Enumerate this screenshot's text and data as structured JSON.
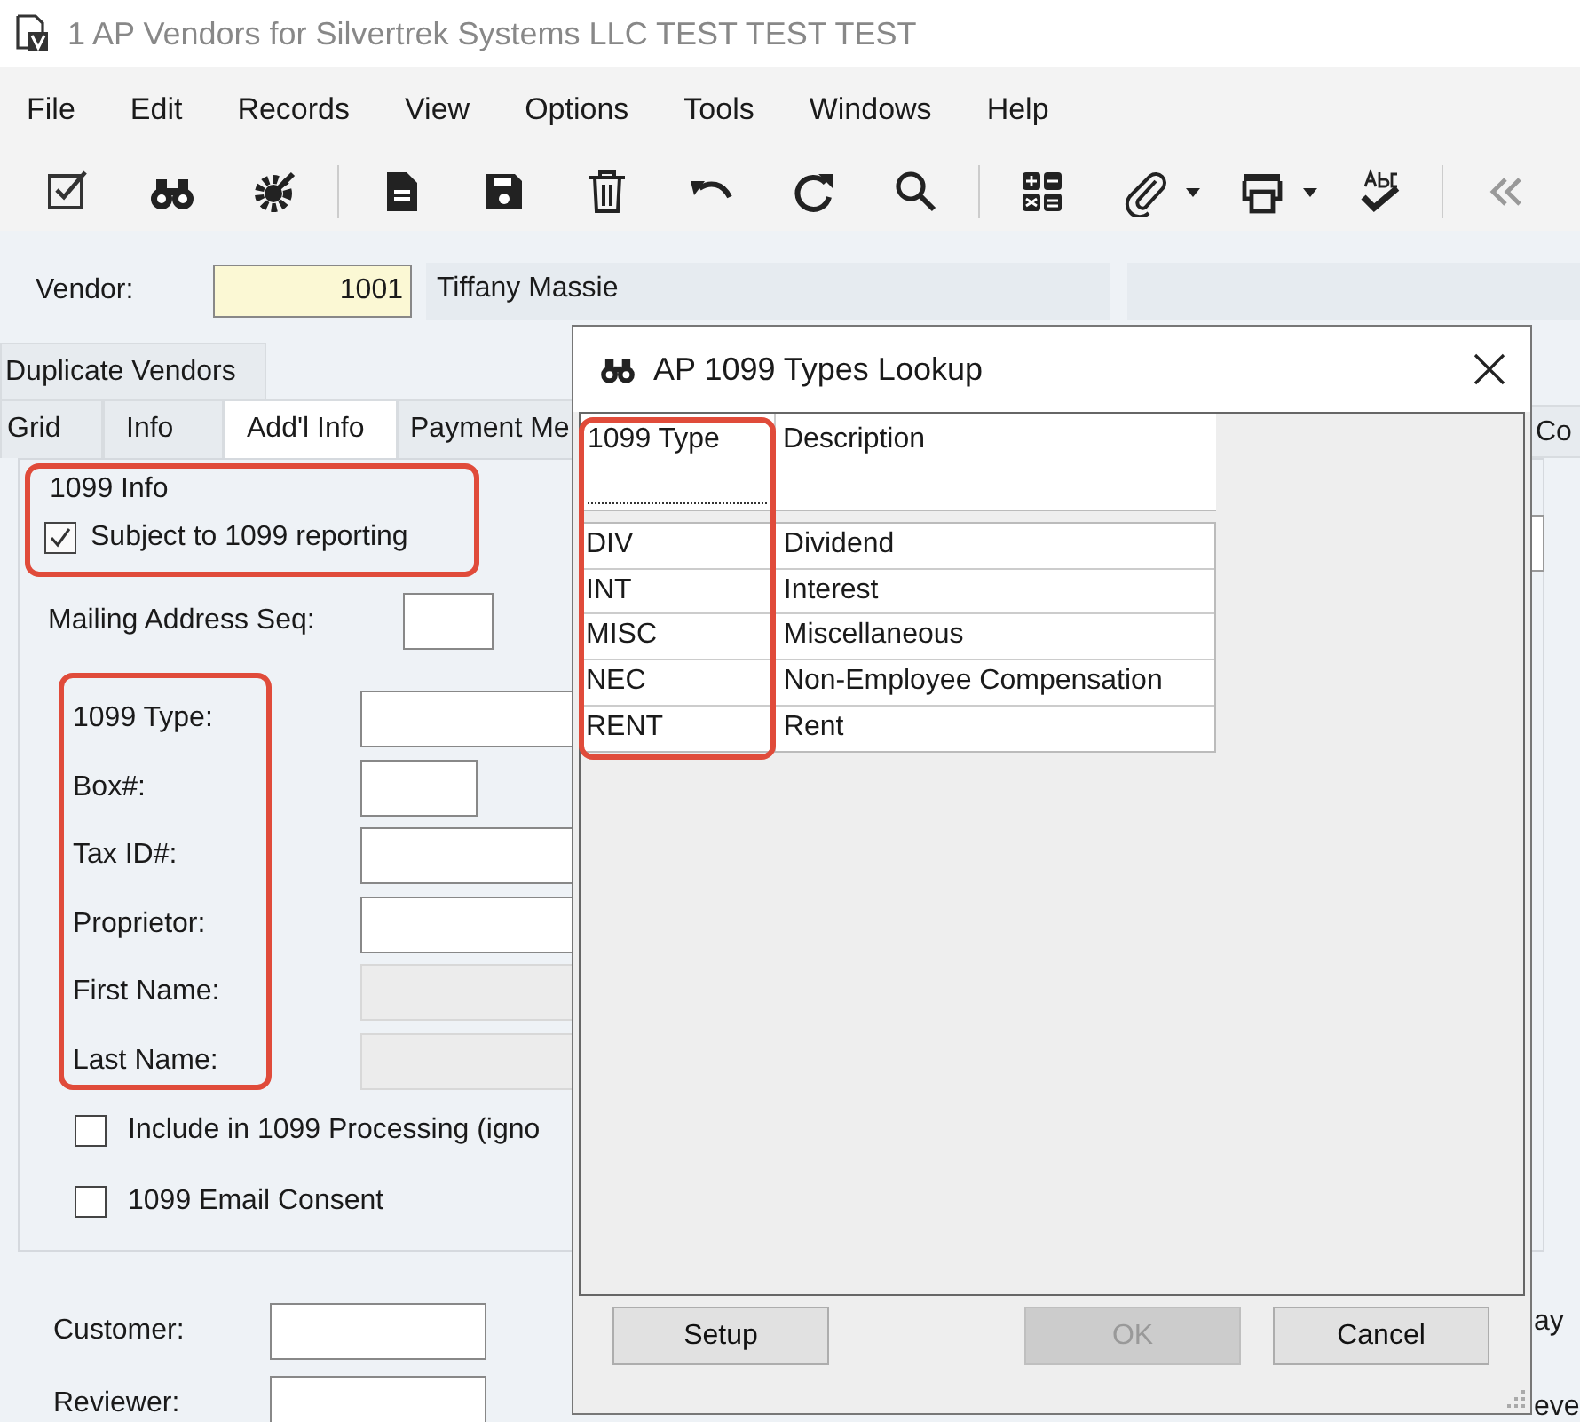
{
  "window": {
    "title": "1 AP Vendors for Silvertrek Systems LLC TEST TEST TEST"
  },
  "menu": [
    "File",
    "Edit",
    "Records",
    "View",
    "Options",
    "Tools",
    "Windows",
    "Help"
  ],
  "vendor": {
    "label": "Vendor:",
    "code": "1001",
    "name": "Tiffany Massie"
  },
  "tabs_top": [
    {
      "label": "Duplicate Vendors",
      "selected": false
    }
  ],
  "tabs": [
    {
      "label": "Grid",
      "selected": false
    },
    {
      "label": "Info",
      "selected": false
    },
    {
      "label": "Add'l Info",
      "selected": true
    },
    {
      "label": "Payment Me",
      "selected": false
    }
  ],
  "right_tab": {
    "label": "Co",
    "selected": false
  },
  "group": {
    "title": "1099 Info",
    "subject": {
      "label": "Subject to 1099 reporting",
      "checked": true
    }
  },
  "mailing": {
    "label": "Mailing Address Seq:"
  },
  "fields": [
    {
      "label": "1099 Type:",
      "kind": "wide",
      "disabled": false
    },
    {
      "label": "Box#:",
      "kind": "narrow",
      "disabled": false
    },
    {
      "label": "Tax ID#:",
      "kind": "wide",
      "disabled": false
    },
    {
      "label": "Proprietor:",
      "kind": "wide",
      "disabled": false
    },
    {
      "label": "First Name:",
      "kind": "wide",
      "disabled": true
    },
    {
      "label": "Last Name:",
      "kind": "wide",
      "disabled": true
    }
  ],
  "checkboxes": [
    {
      "label": "Include in 1099 Processing (igno",
      "checked": false
    },
    {
      "label": "1099 Email Consent",
      "checked": false
    }
  ],
  "lower_fields": [
    {
      "label": "Customer:"
    },
    {
      "label": "Reviewer:"
    }
  ],
  "right_partial_texts": [
    "ay",
    "eve"
  ],
  "dialog": {
    "title": "AP 1099 Types Lookup",
    "columns": [
      "1099 Type",
      "Description"
    ],
    "rows": [
      {
        "type": "DIV",
        "description": "Dividend"
      },
      {
        "type": "INT",
        "description": "Interest"
      },
      {
        "type": "MISC",
        "description": "Miscellaneous"
      },
      {
        "type": "NEC",
        "description": "Non-Employee Compensation"
      },
      {
        "type": "RENT",
        "description": "Rent"
      }
    ],
    "buttons": [
      {
        "label": "Setup",
        "disabled": false
      },
      {
        "label": "OK",
        "disabled": true
      },
      {
        "label": "Cancel",
        "disabled": false
      }
    ]
  }
}
